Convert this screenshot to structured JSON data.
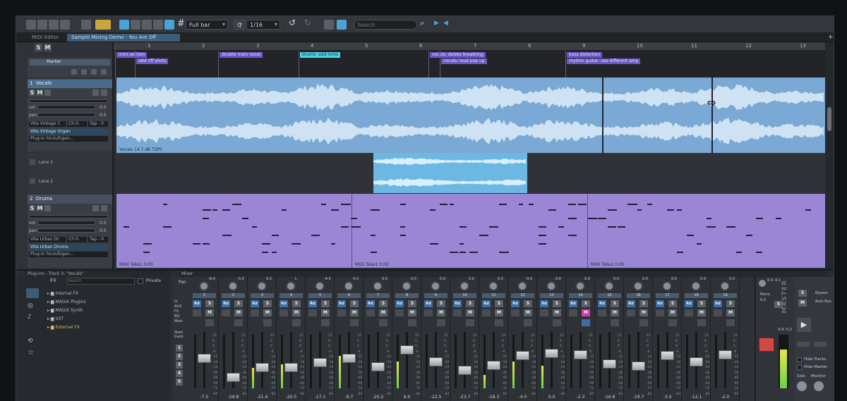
{
  "toolbar": {
    "grid_mode": "Full bar",
    "quantize": "Q",
    "quantize_value": "1/16",
    "search_placeholder": "Search"
  },
  "tabs": [
    {
      "label": "MIDI Editor"
    },
    {
      "label": "Sample Mixing Demo - You Are Off"
    }
  ],
  "solo_mute": {
    "solo": "S",
    "mute": "M"
  },
  "marker_track_label": "Marker",
  "ruler": [
    "1",
    "2",
    "3",
    "4",
    "5",
    "6",
    "7",
    "8",
    "9",
    "10",
    "11",
    "12",
    "13"
  ],
  "markers": [
    {
      "label": "intro section",
      "kind": "purple"
    },
    {
      "label": "add riff shots",
      "kind": "purple"
    },
    {
      "label": "double main vocal",
      "kind": "purple"
    },
    {
      "label": "drums: add toms",
      "kind": "cyan"
    },
    {
      "label": "vocals: delete breathing",
      "kind": "purple"
    },
    {
      "label": "vocals: loud pop up",
      "kind": "purple"
    },
    {
      "label": "bass distortion",
      "kind": "purple"
    },
    {
      "label": "rhythm guitar: use different amp",
      "kind": "purple"
    }
  ],
  "tracks": {
    "vocals": {
      "number": "1",
      "name": "Vocals",
      "vol_label": "vol",
      "vol_value": "0.0",
      "pan_label": "pan",
      "pan_value": "0.0",
      "instrument": "Vita Vintage C",
      "instrument_extra": "Ch 0-",
      "tap": "Tap - 0",
      "plugin": "Vita Vintage Organ",
      "plugin_add": "Plug-in hinzufügen...",
      "clip_label": "Vocals    14.7 dB  TSPS"
    },
    "lanes": [
      "Lane 1",
      "Lane 2"
    ],
    "drums": {
      "number": "2",
      "name": "Drums",
      "vol_label": "vol",
      "vol_value": "0.0",
      "pan_label": "pan",
      "pan_value": "0.0",
      "instrument": "Vita Urban Dr",
      "instrument_extra": "Ch 0-",
      "tap": "Tap - 0",
      "plugin": "Vita Urban Drums",
      "plugin_add": "Plug-in hinzufügen...",
      "clip_labels": [
        "MIDI Take1    0:00",
        "MIDI Take1    0:00",
        "MIDI Take1    0:00"
      ]
    }
  },
  "plugin_panel": {
    "title": "Plug-ins - Track 3: \"Vocals\"",
    "fx_label": "FX",
    "search_placeholder": "Search",
    "private_label": "Private",
    "items": [
      "Internal FX",
      "MAGIX Plugins",
      "MAGIX Synth",
      "VST",
      "External FX"
    ]
  },
  "mixer": {
    "title": "Mixer",
    "pan_label": "Pan",
    "row_labels": [
      "In",
      "AUX",
      "FX",
      "EQ",
      "Main"
    ],
    "start_track_label": "Start track",
    "start_track_numbers": [
      "1",
      "2",
      "3",
      "4",
      "5"
    ],
    "strips": [
      {
        "ch": "1",
        "pan": "-8.0",
        "vol": "-7.5",
        "fader": 0.55,
        "meter": 0.0
      },
      {
        "ch": "2",
        "pan": "-3.0",
        "vol": "-29.8",
        "fader": 0.15,
        "meter": 0.0
      },
      {
        "ch": "3",
        "pan": "0.0",
        "vol": "-21.4",
        "fader": 0.35,
        "meter": 0.38
      },
      {
        "ch": "4",
        "pan": "L",
        "vol": "-20.5",
        "fader": 0.35,
        "meter": 0.45
      },
      {
        "ch": "5",
        "pan": "-4.5",
        "vol": "-17.1",
        "fader": 0.45,
        "meter": 0.0
      },
      {
        "ch": "6",
        "pan": "4.3",
        "vol": "-9.7",
        "fader": 0.55,
        "meter": 0.6
      },
      {
        "ch": "7",
        "pan": "0.0",
        "vol": "-20.2",
        "fader": 0.37,
        "meter": 0.0
      },
      {
        "ch": "8",
        "pan": "0.0",
        "vol": "6.0",
        "fader": 0.72,
        "meter": 0.5
      },
      {
        "ch": "9",
        "pan": "0.0",
        "vol": "-12.5",
        "fader": 0.47,
        "meter": 0.0
      },
      {
        "ch": "10",
        "pan": "0.0",
        "vol": "-23.7",
        "fader": 0.3,
        "meter": 0.0
      },
      {
        "ch": "11",
        "pan": "0.0",
        "vol": "-18.3",
        "fader": 0.4,
        "meter": 0.25
      },
      {
        "ch": "12",
        "pan": "0.0",
        "vol": "-4.0",
        "fader": 0.6,
        "meter": 0.5
      },
      {
        "ch": "13",
        "pan": "0.0",
        "vol": "0.0",
        "fader": 0.65,
        "meter": 0.42
      },
      {
        "ch": "14",
        "pan": "0.0",
        "vol": "-2.3",
        "fader": 0.62,
        "meter": 0.0
      },
      {
        "ch": "15",
        "pan": "0.0",
        "vol": "-16.8",
        "fader": 0.43,
        "meter": 0.0
      },
      {
        "ch": "16",
        "pan": "0.0",
        "vol": "-19.7",
        "fader": 0.38,
        "meter": 0.0
      },
      {
        "ch": "17",
        "pan": "0.0",
        "vol": "-3.4",
        "fader": 0.61,
        "meter": 0.0
      },
      {
        "ch": "18",
        "pan": "0.0",
        "vol": "-12.1",
        "fader": 0.47,
        "meter": 0.0
      },
      {
        "ch": "19",
        "pan": "0.0",
        "vol": "-2.0",
        "fader": 0.62,
        "meter": 0.0
      }
    ],
    "rd_label": "Rd",
    "s_label": "S",
    "m_label": "M",
    "scale": [
      "12",
      "6",
      "0",
      "-6",
      "-12",
      "-18",
      "-24",
      "-36",
      "-48",
      "-60",
      "-72",
      "-84"
    ],
    "master_label": "MASTER",
    "master_values": [
      "0.4",
      "-0.1"
    ],
    "master_readouts": [
      "-0.6",
      "-0.2"
    ],
    "master_meter": 0.72,
    "mono_label": "Mono",
    "mono_value": "0.0",
    "bypass_label": "Bypass",
    "auto_label": "Auto Run",
    "hide_tracks": "Hide Tracks",
    "hide_master": "Hide Master",
    "solo_label": "Solo",
    "monitor_label": "Monitor"
  },
  "colors": {
    "vocal_clip": "#79a9d4",
    "drum_clip": "#9b86d6",
    "marker": "#6b57c9",
    "marker_cyan": "#4fd2e6"
  }
}
